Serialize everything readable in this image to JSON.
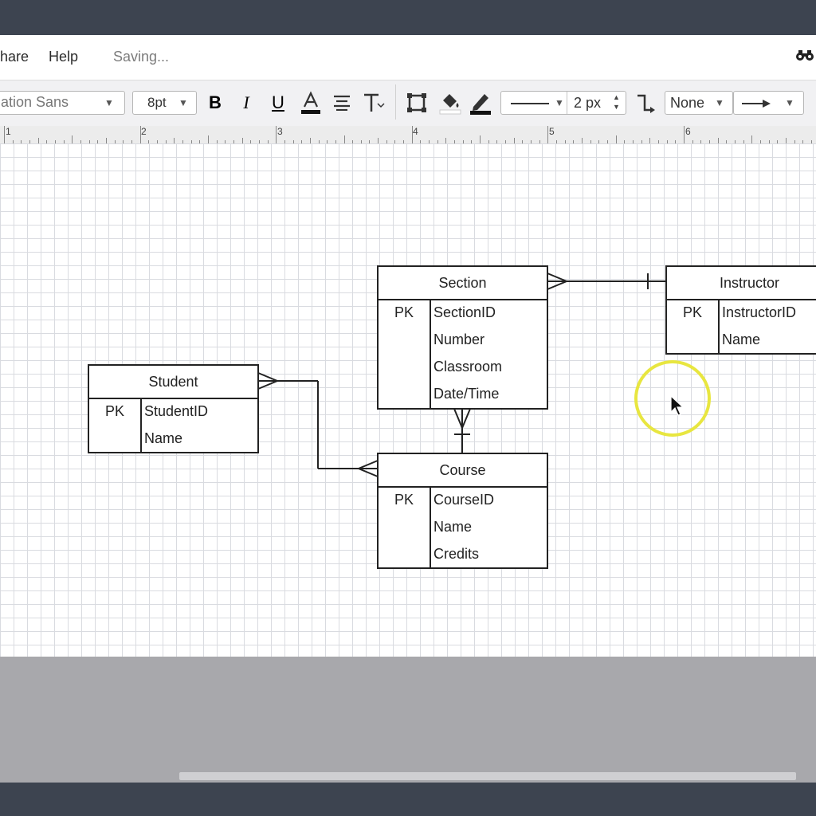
{
  "menu": {
    "share": "hare",
    "help": "Help",
    "status": "Saving..."
  },
  "toolbar": {
    "font_family": "ation Sans",
    "font_size": "8pt",
    "line_width": "2 px",
    "arrow_start": "None"
  },
  "ruler": [
    "1",
    "2",
    "3",
    "4",
    "5",
    "6"
  ],
  "entities": {
    "section": {
      "title": "Section",
      "pk": "PK",
      "attrs": [
        "SectionID",
        "Number",
        "Classroom",
        "Date/Time"
      ]
    },
    "instructor": {
      "title": "Instructor",
      "pk": "PK",
      "attrs": [
        "InstructorID",
        "Name"
      ]
    },
    "student": {
      "title": "Student",
      "pk": "PK",
      "attrs": [
        "StudentID",
        "Name"
      ]
    },
    "course": {
      "title": "Course",
      "pk": "PK",
      "attrs": [
        "CourseID",
        "Name",
        "Credits"
      ]
    }
  },
  "colors": {
    "topbar": "#3d4450",
    "cursor_highlight": "#e8e640"
  }
}
